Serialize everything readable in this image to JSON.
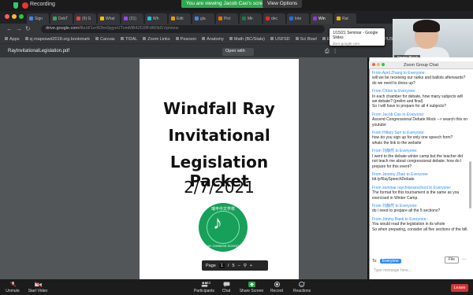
{
  "zoom_top": {
    "recording_label": "Recording",
    "viewing_banner": "You are viewing Jacob Cao's screen",
    "view_options": "View Options"
  },
  "browser": {
    "tabs": [
      "Sign",
      "DebT",
      "(9) G",
      "What",
      "(31)",
      "Wh",
      "Edit",
      "gla",
      "Pict",
      "Mir",
      "dec",
      "Inte",
      "Win",
      "Rat"
    ],
    "url_host": "drive.google.com",
    "url_path": "/file/d/1vr9Dhn0pjyeUTvmMB4ZD2fFdW3d1Vp/view",
    "bookmarks": [
      "Apps",
      "sj.mapeswd2018.org.bookmark",
      "Canvas",
      "TIDAL",
      "Zoom Links",
      "Pearson",
      "Anatomy",
      "Math (BC/Stats)",
      "USFSD",
      "Sci Bowl",
      "English",
      "Chemistry",
      "APUSH",
      "Exercise"
    ],
    "pdf_title": "RayInvitationalLegislation.pdf",
    "open_with": "Open with"
  },
  "tooltip": {
    "title": "1/15/21 Seminar - Google Slides",
    "sub": "docs.google.com"
  },
  "camera": {
    "name": "Jimmy Baek"
  },
  "document": {
    "title_lines": [
      "Windfall Ray",
      "Invitational",
      "Legislation Packet"
    ],
    "date": "2/7/2021",
    "logo_top": "瑞丰中文学校",
    "logo_bottom": "RAY CHINESE SCHOOL",
    "page_label": "Page",
    "page_num": "1",
    "page_sep": "/",
    "page_total": "5"
  },
  "chat": {
    "header": "Zoom Group Chat",
    "messages": [
      {
        "from": "From April Zhang to Everyone:",
        "text": "will we be receiving our ranks and ballots afterwards?\ndo we need to dress up?"
      },
      {
        "from": "From Chloe to Everyone:",
        "text": "In each chamber for debate, how many subjects will we debate? (prelim and final)\nSo I will have to prepare for all 4 subjects?"
      },
      {
        "from": "From Jacob Cao to Everyone:",
        "text": "Ascend Congressional Debate Mock --> search this on youtube"
      },
      {
        "from": "From Hillary Sun to Everyone:",
        "text": "how do you sign up for only one speech form?\nwhats the link to the website"
      },
      {
        "from": "From 刘静然 to Everyone:",
        "text": "I went to the debate winter camp but the teacher did not teach me about congressional debate. how do I prepare for this event?"
      },
      {
        "from": "From Jeremy Zhao to Everyone:",
        "text": "bit.ly/RaySpeechDebate"
      },
      {
        "from": "From seminar raychineseschool to Everyone:",
        "text": "The format for this tournament is the same as you exercised in Winter Camp."
      },
      {
        "from": "From 刘静然 to Everyone:",
        "text": "do i need to prepare all the 5 sections?"
      },
      {
        "from": "From Jimmy Baek to Everyone:",
        "text": "You would read the legislation in its whole\nSo when preparing, consider all five sections of the bill."
      }
    ],
    "to_label": "To:",
    "to_value": "Everyone",
    "file_label": "File",
    "more_label": "...",
    "input_placeholder": "Type message here..."
  },
  "toolbar": {
    "unmute": "Unmute",
    "start_video": "Start Video",
    "participants": "Participants",
    "participants_count": "33",
    "chat": "Chat",
    "share_screen": "Share Screen",
    "record": "Record",
    "reactions": "Reactions",
    "leave": "Leave"
  },
  "colors": {
    "zoom_green": "#2fa84f",
    "zoom_blue": "#2d8cff",
    "leave_red": "#d63131",
    "logo_green": "#16a05a"
  }
}
